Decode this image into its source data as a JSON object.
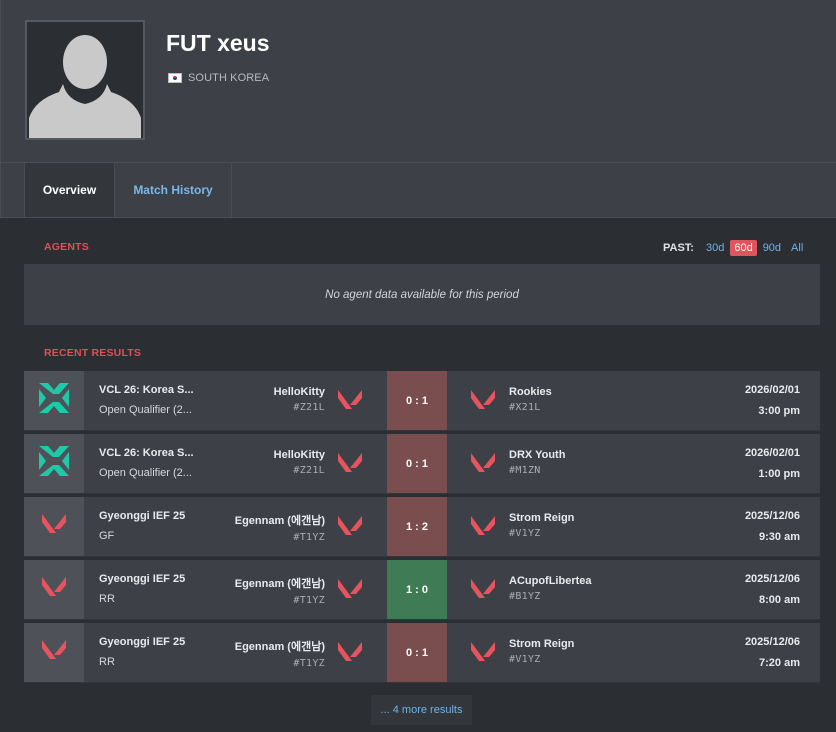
{
  "player": {
    "name": "FUT xeus",
    "country": "SOUTH KOREA"
  },
  "tabs": [
    {
      "label": "Overview",
      "active": true
    },
    {
      "label": "Match History",
      "active": false
    }
  ],
  "agents": {
    "section_label": "AGENTS",
    "past_label": "PAST:",
    "ranges": [
      "30d",
      "60d",
      "90d",
      "All"
    ],
    "active_range": "60d",
    "empty_message": "No agent data available for this period"
  },
  "recent_results": {
    "section_label": "RECENT RESULTS",
    "rows": [
      {
        "icon": "vcl-logo-icon",
        "event": "VCL 26: Korea S...",
        "stage": "Open Qualifier (2...",
        "team1": "HelloKitty",
        "team1_tag": "#Z21L",
        "score": "0 : 1",
        "result": "loss",
        "team2": "Rookies",
        "team2_tag": "#X21L",
        "date": "2026/02/01",
        "time": "3:00 pm"
      },
      {
        "icon": "vcl-logo-icon",
        "event": "VCL 26: Korea S...",
        "stage": "Open Qualifier (2...",
        "team1": "HelloKitty",
        "team1_tag": "#Z21L",
        "score": "0 : 1",
        "result": "loss",
        "team2": "DRX Youth",
        "team2_tag": "#M1ZN",
        "date": "2026/02/01",
        "time": "1:00 pm"
      },
      {
        "icon": "valorant-logo-icon",
        "event": "Gyeonggi IEF 25",
        "stage": "GF",
        "team1": "Egennam (에갠남)",
        "team1_tag": "#T1YZ",
        "score": "1 : 2",
        "result": "loss",
        "team2": "Strom Reign",
        "team2_tag": "#V1YZ",
        "date": "2025/12/06",
        "time": "9:30 am"
      },
      {
        "icon": "valorant-logo-icon",
        "event": "Gyeonggi IEF 25",
        "stage": "RR",
        "team1": "Egennam (에갠남)",
        "team1_tag": "#T1YZ",
        "score": "1 : 0",
        "result": "win",
        "team2": "ACupofLibertea",
        "team2_tag": "#B1YZ",
        "date": "2025/12/06",
        "time": "8:00 am"
      },
      {
        "icon": "valorant-logo-icon",
        "event": "Gyeonggi IEF 25",
        "stage": "RR",
        "team1": "Egennam (에갠남)",
        "team1_tag": "#T1YZ",
        "score": "0 : 1",
        "result": "loss",
        "team2": "Strom Reign",
        "team2_tag": "#V1YZ",
        "date": "2025/12/06",
        "time": "7:20 am"
      }
    ],
    "more_label": "... 4 more results"
  },
  "colors": {
    "accent_red": "#e0505a",
    "link_blue": "#6fb3e8",
    "loss": "#7a4d4f",
    "win": "#3f7b54"
  }
}
